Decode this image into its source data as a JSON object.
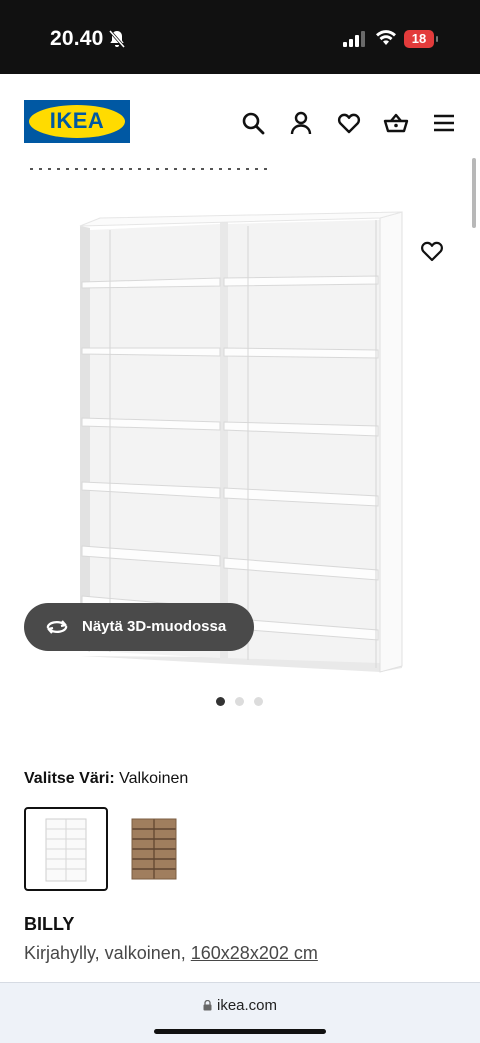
{
  "status_bar": {
    "time": "20.40",
    "battery": "18",
    "icons": [
      "bell-slash-icon",
      "signal-icon",
      "wifi-icon",
      "battery-icon"
    ]
  },
  "header": {
    "logo_text": "IKEA",
    "icons": [
      "search-icon",
      "user-icon",
      "heart-icon",
      "basket-icon",
      "menu-icon"
    ],
    "brand_colors": {
      "blue": "#0058a3",
      "yellow": "#ffdb00"
    }
  },
  "gallery": {
    "view_3d_label": "Näytä 3D-muodossa",
    "active_slide": 1,
    "slide_count": 3,
    "favourite_icon": "heart-icon"
  },
  "color_picker": {
    "label": "Valitse Väri:",
    "selected_value": "Valkoinen",
    "options": [
      {
        "name": "white",
        "color": "#ffffff",
        "selected": true
      },
      {
        "name": "brown-oak",
        "color": "#a07e5e",
        "selected": false
      }
    ]
  },
  "product": {
    "name": "BILLY",
    "description": "Kirjahylly, valkoinen,",
    "dimensions": "160x28x202 cm"
  },
  "browser": {
    "url": "ikea.com"
  }
}
